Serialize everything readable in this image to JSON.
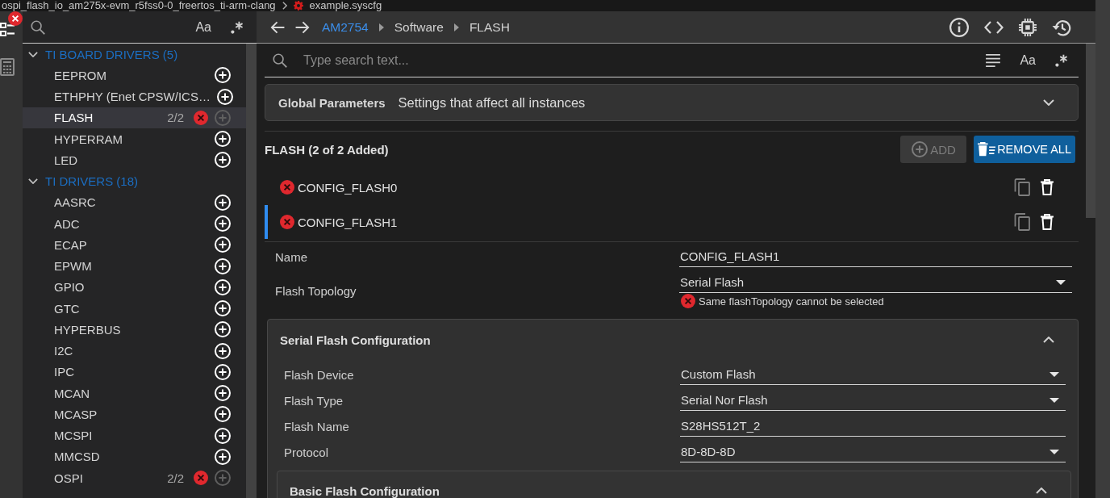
{
  "title_bar": {
    "path": "ospi_flash_io_am275x-evm_r5fss0-0_freertos_ti-arm-clang",
    "file": "example.syscfg"
  },
  "activity_bar": [
    {
      "selected": true,
      "error": true
    },
    {
      "selected": false,
      "error": false
    }
  ],
  "sidebar": {
    "case_toggle": "Aa",
    "groups": [
      {
        "label": "TI BOARD DRIVERS (5)",
        "expanded": true,
        "items": [
          {
            "label": "EEPROM",
            "selected": false,
            "error": false,
            "add_enabled": true
          },
          {
            "label": "ETHPHY (Enet CPSW/ICS…",
            "selected": false,
            "error": false,
            "add_enabled": true
          },
          {
            "label": "FLASH",
            "count": "2/2",
            "selected": true,
            "error": true,
            "add_enabled": false
          },
          {
            "label": "HYPERRAM",
            "selected": false,
            "error": false,
            "add_enabled": true
          },
          {
            "label": "LED",
            "selected": false,
            "error": false,
            "add_enabled": true
          }
        ]
      },
      {
        "label": "TI DRIVERS (18)",
        "expanded": true,
        "items": [
          {
            "label": "AASRC",
            "selected": false,
            "error": false,
            "add_enabled": true
          },
          {
            "label": "ADC",
            "selected": false,
            "error": false,
            "add_enabled": true
          },
          {
            "label": "ECAP",
            "selected": false,
            "error": false,
            "add_enabled": true
          },
          {
            "label": "EPWM",
            "selected": false,
            "error": false,
            "add_enabled": true
          },
          {
            "label": "GPIO",
            "selected": false,
            "error": false,
            "add_enabled": true
          },
          {
            "label": "GTC",
            "selected": false,
            "error": false,
            "add_enabled": true
          },
          {
            "label": "HYPERBUS",
            "selected": false,
            "error": false,
            "add_enabled": true
          },
          {
            "label": "I2C",
            "selected": false,
            "error": false,
            "add_enabled": true
          },
          {
            "label": "IPC",
            "selected": false,
            "error": false,
            "add_enabled": true
          },
          {
            "label": "MCAN",
            "selected": false,
            "error": false,
            "add_enabled": true
          },
          {
            "label": "MCASP",
            "selected": false,
            "error": false,
            "add_enabled": true
          },
          {
            "label": "MCSPI",
            "selected": false,
            "error": false,
            "add_enabled": true
          },
          {
            "label": "MMCSD",
            "selected": false,
            "error": false,
            "add_enabled": true
          },
          {
            "label": "OSPI",
            "count": "2/2",
            "selected": false,
            "error": true,
            "add_enabled": false
          }
        ]
      }
    ]
  },
  "nav": {
    "breadcrumb": [
      {
        "label": "AM2754",
        "link": true
      },
      {
        "label": "Software",
        "link": false
      },
      {
        "label": "FLASH",
        "link": false
      }
    ]
  },
  "search": {
    "placeholder": "Type search text...",
    "case_toggle": "Aa"
  },
  "global_parameters": {
    "title": "Global Parameters",
    "description": "Settings that affect all instances",
    "expanded": false
  },
  "module": {
    "title": "FLASH (2 of 2 Added)",
    "add_button": {
      "label": "ADD",
      "disabled": true
    },
    "remove_all_button": {
      "label": "REMOVE ALL",
      "disabled": false
    },
    "instances": [
      {
        "name": "CONFIG_FLASH0",
        "selected": false,
        "error": true
      },
      {
        "name": "CONFIG_FLASH1",
        "selected": true,
        "error": true
      }
    ]
  },
  "properties": [
    {
      "label": "Name",
      "kind": "text",
      "value": "CONFIG_FLASH1"
    },
    {
      "label": "Flash Topology",
      "kind": "select",
      "value": "Serial Flash",
      "error": "Same flashTopology cannot be selected"
    }
  ],
  "sections": [
    {
      "title": "Serial Flash Configuration",
      "expanded": true,
      "properties": [
        {
          "label": "Flash Device",
          "kind": "select",
          "value": "Custom Flash"
        },
        {
          "label": "Flash Type",
          "kind": "select",
          "value": "Serial Nor Flash"
        },
        {
          "label": "Flash Name",
          "kind": "text",
          "value": "S28HS512T_2"
        },
        {
          "label": "Protocol",
          "kind": "select",
          "value": "8D-8D-8D"
        }
      ],
      "sections": [
        {
          "title": "Basic Flash Configuration",
          "expanded": true
        }
      ]
    }
  ]
}
